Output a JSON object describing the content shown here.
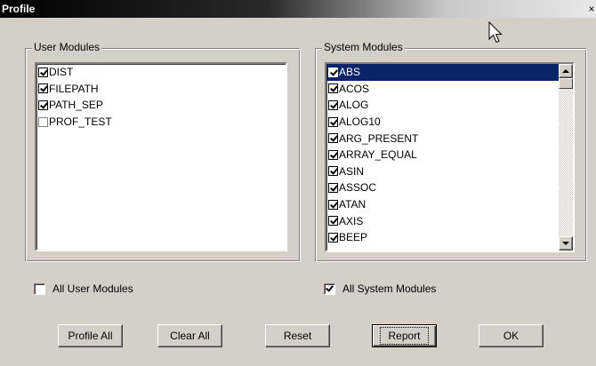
{
  "window": {
    "title": "Profile",
    "close_glyph": "×"
  },
  "user_modules": {
    "legend": "User Modules",
    "items": [
      {
        "label": "DIST",
        "checked": true
      },
      {
        "label": "FILEPATH",
        "checked": true
      },
      {
        "label": "PATH_SEP",
        "checked": true
      },
      {
        "label": "PROF_TEST",
        "checked": false
      }
    ]
  },
  "system_modules": {
    "legend": "System Modules",
    "items": [
      {
        "label": "ABS",
        "checked": true,
        "selected": true
      },
      {
        "label": "ACOS",
        "checked": true
      },
      {
        "label": "ALOG",
        "checked": true
      },
      {
        "label": "ALOG10",
        "checked": true
      },
      {
        "label": "ARG_PRESENT",
        "checked": true
      },
      {
        "label": "ARRAY_EQUAL",
        "checked": true
      },
      {
        "label": "ASIN",
        "checked": true
      },
      {
        "label": "ASSOC",
        "checked": true
      },
      {
        "label": "ATAN",
        "checked": true
      },
      {
        "label": "AXIS",
        "checked": true
      },
      {
        "label": "BEEP",
        "checked": true
      }
    ]
  },
  "options": {
    "all_user_modules": {
      "label": "All User Modules",
      "checked": false
    },
    "all_system_modules": {
      "label": "All System Modules",
      "checked": true
    }
  },
  "buttons": {
    "profile_all": "Profile All",
    "clear_all": "Clear All",
    "reset": "Reset",
    "report": "Report",
    "ok": "OK"
  },
  "icons": {
    "close": "close-icon",
    "cursor": "arrow-cursor-icon",
    "scroll_up": "scroll-up-arrow-icon",
    "scroll_down": "scroll-down-arrow-icon"
  },
  "colors": {
    "selection": "#0a246a",
    "face": "#d4d0c8"
  }
}
